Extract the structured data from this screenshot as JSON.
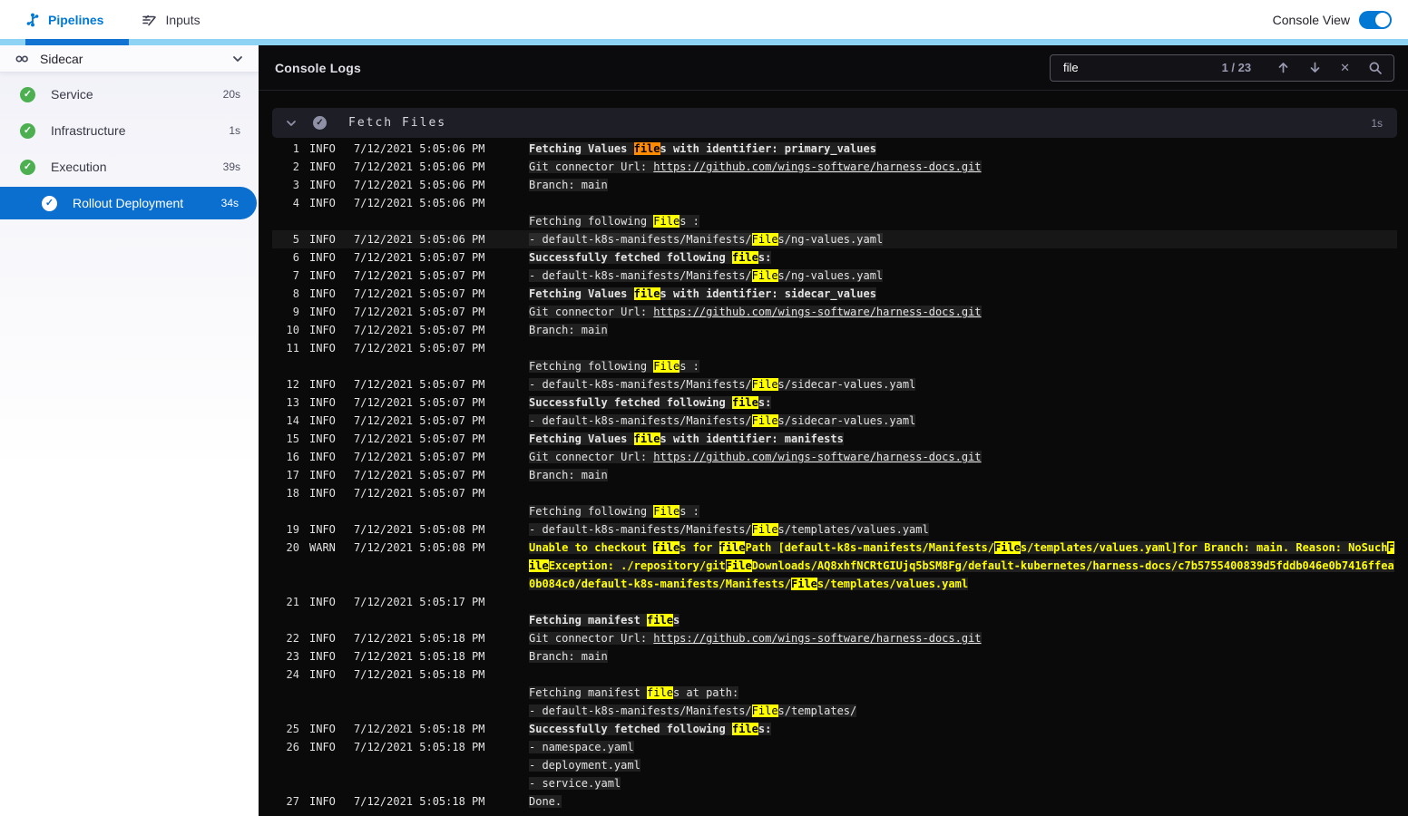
{
  "topbar": {
    "tabs": [
      {
        "label": "Pipelines",
        "active": true
      },
      {
        "label": "Inputs",
        "active": false
      }
    ],
    "console_view_label": "Console View",
    "console_view_on": true
  },
  "sidebar": {
    "title": "Sidecar",
    "items": [
      {
        "label": "Service",
        "duration": "20s",
        "status": "success",
        "selected": false,
        "indent": false
      },
      {
        "label": "Infrastructure",
        "duration": "1s",
        "status": "success",
        "selected": false,
        "indent": false
      },
      {
        "label": "Execution",
        "duration": "39s",
        "status": "success",
        "selected": false,
        "indent": false
      },
      {
        "label": "Rollout Deployment",
        "duration": "34s",
        "status": "success",
        "selected": true,
        "indent": true
      }
    ]
  },
  "console": {
    "title": "Console Logs",
    "search": {
      "value": "file",
      "counter": "1 / 23"
    },
    "group": {
      "title": "Fetch Files",
      "duration": "1s"
    },
    "entries": [
      {
        "n": 1,
        "lvl": "INFO",
        "ts": "7/12/2021 5:05:06 PM",
        "rows": [
          [
            [
              "Fetching Values ",
              "b"
            ],
            [
              "file",
              "o"
            ],
            [
              "s with identifier: primary_values",
              "b"
            ]
          ]
        ]
      },
      {
        "n": 2,
        "lvl": "INFO",
        "ts": "7/12/2021 5:05:06 PM",
        "rows": [
          [
            [
              "Git connector Url: ",
              ""
            ],
            [
              "https://github.com/wings-software/harness-docs.git",
              "l"
            ]
          ]
        ]
      },
      {
        "n": 3,
        "lvl": "INFO",
        "ts": "7/12/2021 5:05:06 PM",
        "rows": [
          [
            [
              "Branch: main",
              ""
            ]
          ]
        ]
      },
      {
        "n": 4,
        "lvl": "INFO",
        "ts": "7/12/2021 5:05:06 PM",
        "rows": [
          [],
          [
            [
              "Fetching following ",
              ""
            ],
            [
              "File",
              "h"
            ],
            [
              "s :",
              ""
            ]
          ]
        ]
      },
      {
        "n": 5,
        "lvl": "INFO",
        "ts": "7/12/2021 5:05:06 PM",
        "hl": true,
        "rows": [
          [
            [
              "- default-k8s-manifests/Manifests/",
              ""
            ],
            [
              "File",
              "h"
            ],
            [
              "s/ng-values.yaml",
              ""
            ]
          ]
        ]
      },
      {
        "n": 6,
        "lvl": "INFO",
        "ts": "7/12/2021 5:05:07 PM",
        "rows": [
          [
            [
              "Successfully fetched following ",
              "b"
            ],
            [
              "file",
              "h b"
            ],
            [
              "s:",
              "b"
            ]
          ]
        ]
      },
      {
        "n": 7,
        "lvl": "INFO",
        "ts": "7/12/2021 5:05:07 PM",
        "rows": [
          [
            [
              "- default-k8s-manifests/Manifests/",
              ""
            ],
            [
              "File",
              "h"
            ],
            [
              "s/ng-values.yaml",
              ""
            ]
          ]
        ]
      },
      {
        "n": 8,
        "lvl": "INFO",
        "ts": "7/12/2021 5:05:07 PM",
        "rows": [
          [
            [
              "Fetching Values ",
              "b"
            ],
            [
              "file",
              "h b"
            ],
            [
              "s with identifier: sidecar_values",
              "b"
            ]
          ]
        ]
      },
      {
        "n": 9,
        "lvl": "INFO",
        "ts": "7/12/2021 5:05:07 PM",
        "rows": [
          [
            [
              "Git connector Url: ",
              ""
            ],
            [
              "https://github.com/wings-software/harness-docs.git",
              "l"
            ]
          ]
        ]
      },
      {
        "n": 10,
        "lvl": "INFO",
        "ts": "7/12/2021 5:05:07 PM",
        "rows": [
          [
            [
              "Branch: main",
              ""
            ]
          ]
        ]
      },
      {
        "n": 11,
        "lvl": "INFO",
        "ts": "7/12/2021 5:05:07 PM",
        "rows": [
          [],
          [
            [
              "Fetching following ",
              ""
            ],
            [
              "File",
              "h"
            ],
            [
              "s :",
              ""
            ]
          ]
        ]
      },
      {
        "n": 12,
        "lvl": "INFO",
        "ts": "7/12/2021 5:05:07 PM",
        "rows": [
          [
            [
              "- default-k8s-manifests/Manifests/",
              ""
            ],
            [
              "File",
              "h"
            ],
            [
              "s/sidecar-values.yaml",
              ""
            ]
          ]
        ]
      },
      {
        "n": 13,
        "lvl": "INFO",
        "ts": "7/12/2021 5:05:07 PM",
        "rows": [
          [
            [
              "Successfully fetched following ",
              "b"
            ],
            [
              "file",
              "h b"
            ],
            [
              "s:",
              "b"
            ]
          ]
        ]
      },
      {
        "n": 14,
        "lvl": "INFO",
        "ts": "7/12/2021 5:05:07 PM",
        "rows": [
          [
            [
              "- default-k8s-manifests/Manifests/",
              ""
            ],
            [
              "File",
              "h"
            ],
            [
              "s/sidecar-values.yaml",
              ""
            ]
          ]
        ]
      },
      {
        "n": 15,
        "lvl": "INFO",
        "ts": "7/12/2021 5:05:07 PM",
        "rows": [
          [
            [
              "Fetching Values ",
              "b"
            ],
            [
              "file",
              "h b"
            ],
            [
              "s with identifier: manifests",
              "b"
            ]
          ]
        ]
      },
      {
        "n": 16,
        "lvl": "INFO",
        "ts": "7/12/2021 5:05:07 PM",
        "rows": [
          [
            [
              "Git connector Url: ",
              ""
            ],
            [
              "https://github.com/wings-software/harness-docs.git",
              "l"
            ]
          ]
        ]
      },
      {
        "n": 17,
        "lvl": "INFO",
        "ts": "7/12/2021 5:05:07 PM",
        "rows": [
          [
            [
              "Branch: main",
              ""
            ]
          ]
        ]
      },
      {
        "n": 18,
        "lvl": "INFO",
        "ts": "7/12/2021 5:05:07 PM",
        "rows": [
          [],
          [
            [
              "Fetching following ",
              ""
            ],
            [
              "File",
              "h"
            ],
            [
              "s :",
              ""
            ]
          ]
        ]
      },
      {
        "n": 19,
        "lvl": "INFO",
        "ts": "7/12/2021 5:05:08 PM",
        "rows": [
          [
            [
              "- default-k8s-manifests/Manifests/",
              ""
            ],
            [
              "File",
              "h"
            ],
            [
              "s/templates/values.yaml",
              ""
            ]
          ]
        ]
      },
      {
        "n": 20,
        "lvl": "WARN",
        "ts": "7/12/2021 5:05:08 PM",
        "rows": [
          [
            [
              "Unable to checkout ",
              "w"
            ],
            [
              "file",
              "h b"
            ],
            [
              "s for ",
              "w"
            ],
            [
              "file",
              "h b"
            ],
            [
              "Path [default-k8s-manifests/Manifests/",
              "w"
            ],
            [
              "File",
              "h b"
            ],
            [
              "s/templates/values.yaml]for Branch: main. Reason: NoSuch",
              "w"
            ],
            [
              "File",
              "h b"
            ],
            [
              "Exception: ./repository/git",
              "w"
            ],
            [
              "File",
              "h b"
            ],
            [
              "Downloads/AQ8xhfNCRtGIUjq5bSM8Fg/default-kubernetes/harness-docs/c7b5755400839d5fddb046e0b7416ffea0b084c0/default-k8s-manifests/Manifests/",
              "w"
            ],
            [
              "File",
              "h b"
            ],
            [
              "s/templates/values.yaml",
              "w"
            ]
          ]
        ]
      },
      {
        "n": 21,
        "lvl": "INFO",
        "ts": "7/12/2021 5:05:17 PM",
        "rows": [
          [],
          [
            [
              "Fetching manifest ",
              "b"
            ],
            [
              "file",
              "h b"
            ],
            [
              "s",
              "b"
            ]
          ]
        ]
      },
      {
        "n": 22,
        "lvl": "INFO",
        "ts": "7/12/2021 5:05:18 PM",
        "rows": [
          [
            [
              "Git connector Url: ",
              ""
            ],
            [
              "https://github.com/wings-software/harness-docs.git",
              "l"
            ]
          ]
        ]
      },
      {
        "n": 23,
        "lvl": "INFO",
        "ts": "7/12/2021 5:05:18 PM",
        "rows": [
          [
            [
              "Branch: main",
              ""
            ]
          ]
        ]
      },
      {
        "n": 24,
        "lvl": "INFO",
        "ts": "7/12/2021 5:05:18 PM",
        "rows": [
          [],
          [
            [
              "Fetching manifest ",
              ""
            ],
            [
              "file",
              "h"
            ],
            [
              "s at path:",
              ""
            ]
          ],
          [
            [
              "- default-k8s-manifests/Manifests/",
              ""
            ],
            [
              "File",
              "h"
            ],
            [
              "s/templates/",
              ""
            ]
          ]
        ]
      },
      {
        "n": 25,
        "lvl": "INFO",
        "ts": "7/12/2021 5:05:18 PM",
        "rows": [
          [
            [
              "Successfully fetched following ",
              "b"
            ],
            [
              "file",
              "h b"
            ],
            [
              "s:",
              "b"
            ]
          ]
        ]
      },
      {
        "n": 26,
        "lvl": "INFO",
        "ts": "7/12/2021 5:05:18 PM",
        "rows": [
          [
            [
              "- namespace.yaml",
              ""
            ]
          ],
          [
            [
              "- deployment.yaml",
              ""
            ]
          ],
          [
            [
              "- service.yaml",
              ""
            ]
          ]
        ]
      },
      {
        "n": 27,
        "lvl": "INFO",
        "ts": "7/12/2021 5:05:18 PM",
        "rows": [
          [
            [
              "Done.",
              ""
            ]
          ]
        ]
      }
    ]
  },
  "colors": {
    "accent_blue": "#0278d5",
    "selected_blue": "#0b6fd0",
    "strip_light": "#8ed3f4",
    "strip_dark": "#1373d3",
    "success_green": "#4caf50",
    "match_highlight": "#ffff00",
    "current_match": "#ff8c00",
    "warn_text": "#ffff00",
    "panel_bg": "#0a0a0b",
    "group_header_bg": "#1e1e26"
  }
}
